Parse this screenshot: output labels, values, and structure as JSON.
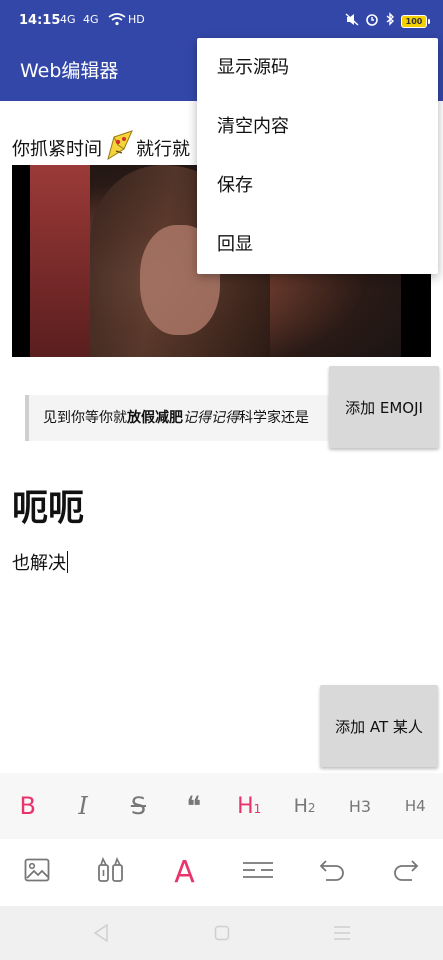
{
  "status_bar": {
    "time": "14:15",
    "signal1": "4G",
    "signal2": "4G",
    "wifi": "HD",
    "battery": "100"
  },
  "app_bar": {
    "title": "Web编辑器"
  },
  "menu": {
    "items": [
      "显示源码",
      "清空内容",
      "保存",
      "回显"
    ]
  },
  "content": {
    "para1_before": "你抓紧时间",
    "para1_after": "就行就",
    "quote": {
      "part1": "见到你等你就",
      "bold": "放假减肥",
      "italic": "记得记得",
      "part2": "科学家还是"
    },
    "heading": "呃呃",
    "para2": "也解决",
    "add_emoji_label": "添加 EMOJI",
    "add_at_label": "添加 AT 某人"
  },
  "toolbar_format": {
    "bold": "B",
    "italic": "I",
    "strike": "S",
    "quote": "❝",
    "h1": "H",
    "h1_sub": "1",
    "h2": "H",
    "h2_sub": "2",
    "h3": "H3",
    "h4": "H4"
  },
  "toolbar_insert": {
    "image_icon": "image-icon",
    "video_icon": "media-icon",
    "text_color": "A",
    "divider_icon": "divider-icon",
    "undo_icon": "undo-icon",
    "redo_icon": "redo-icon"
  },
  "colors": {
    "app_bar": "#3347a8",
    "accent": "#e8336b",
    "button_gray": "#d9d9d9"
  }
}
